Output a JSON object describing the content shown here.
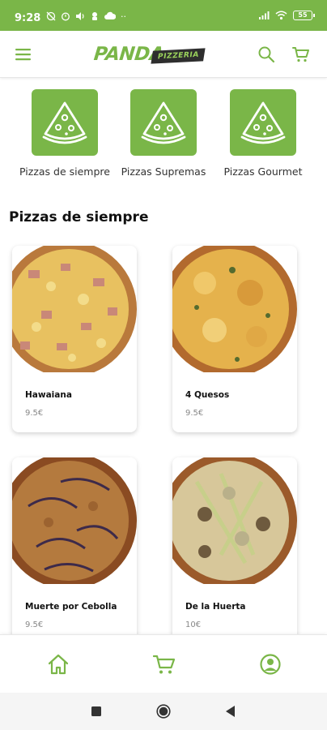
{
  "status_bar": {
    "time": "9:28",
    "left_icons": [
      "alarm-off-icon",
      "alarm-icon",
      "volume-icon",
      "accessibility-icon",
      "cloud-icon",
      "more-icon"
    ],
    "battery": "55"
  },
  "app_bar": {
    "logo_main": "PANDA",
    "logo_tag": "PIZZERIA",
    "icons": [
      "menu-icon",
      "search-icon",
      "cart-icon"
    ]
  },
  "categories": [
    {
      "label": "Pizzas de siempre",
      "icon": "pizza-slice-icon"
    },
    {
      "label": "Pizzas Supremas",
      "icon": "pizza-slice-icon"
    },
    {
      "label": "Pizzas Gourmet",
      "icon": "pizza-slice-icon"
    }
  ],
  "section": {
    "title": "Pizzas de siempre"
  },
  "products": [
    {
      "name": "Hawaiana",
      "price": "9.5€"
    },
    {
      "name": "4 Quesos",
      "price": "9.5€"
    },
    {
      "name": "Muerte por Cebolla",
      "price": "9.5€"
    },
    {
      "name": "De la Huerta",
      "price": "10€"
    }
  ],
  "bottom_nav": [
    "home-icon",
    "cart-icon",
    "profile-icon"
  ],
  "colors": {
    "brand_green": "#7ab648",
    "dark": "#2e2e2e",
    "price_grey": "#888888"
  }
}
